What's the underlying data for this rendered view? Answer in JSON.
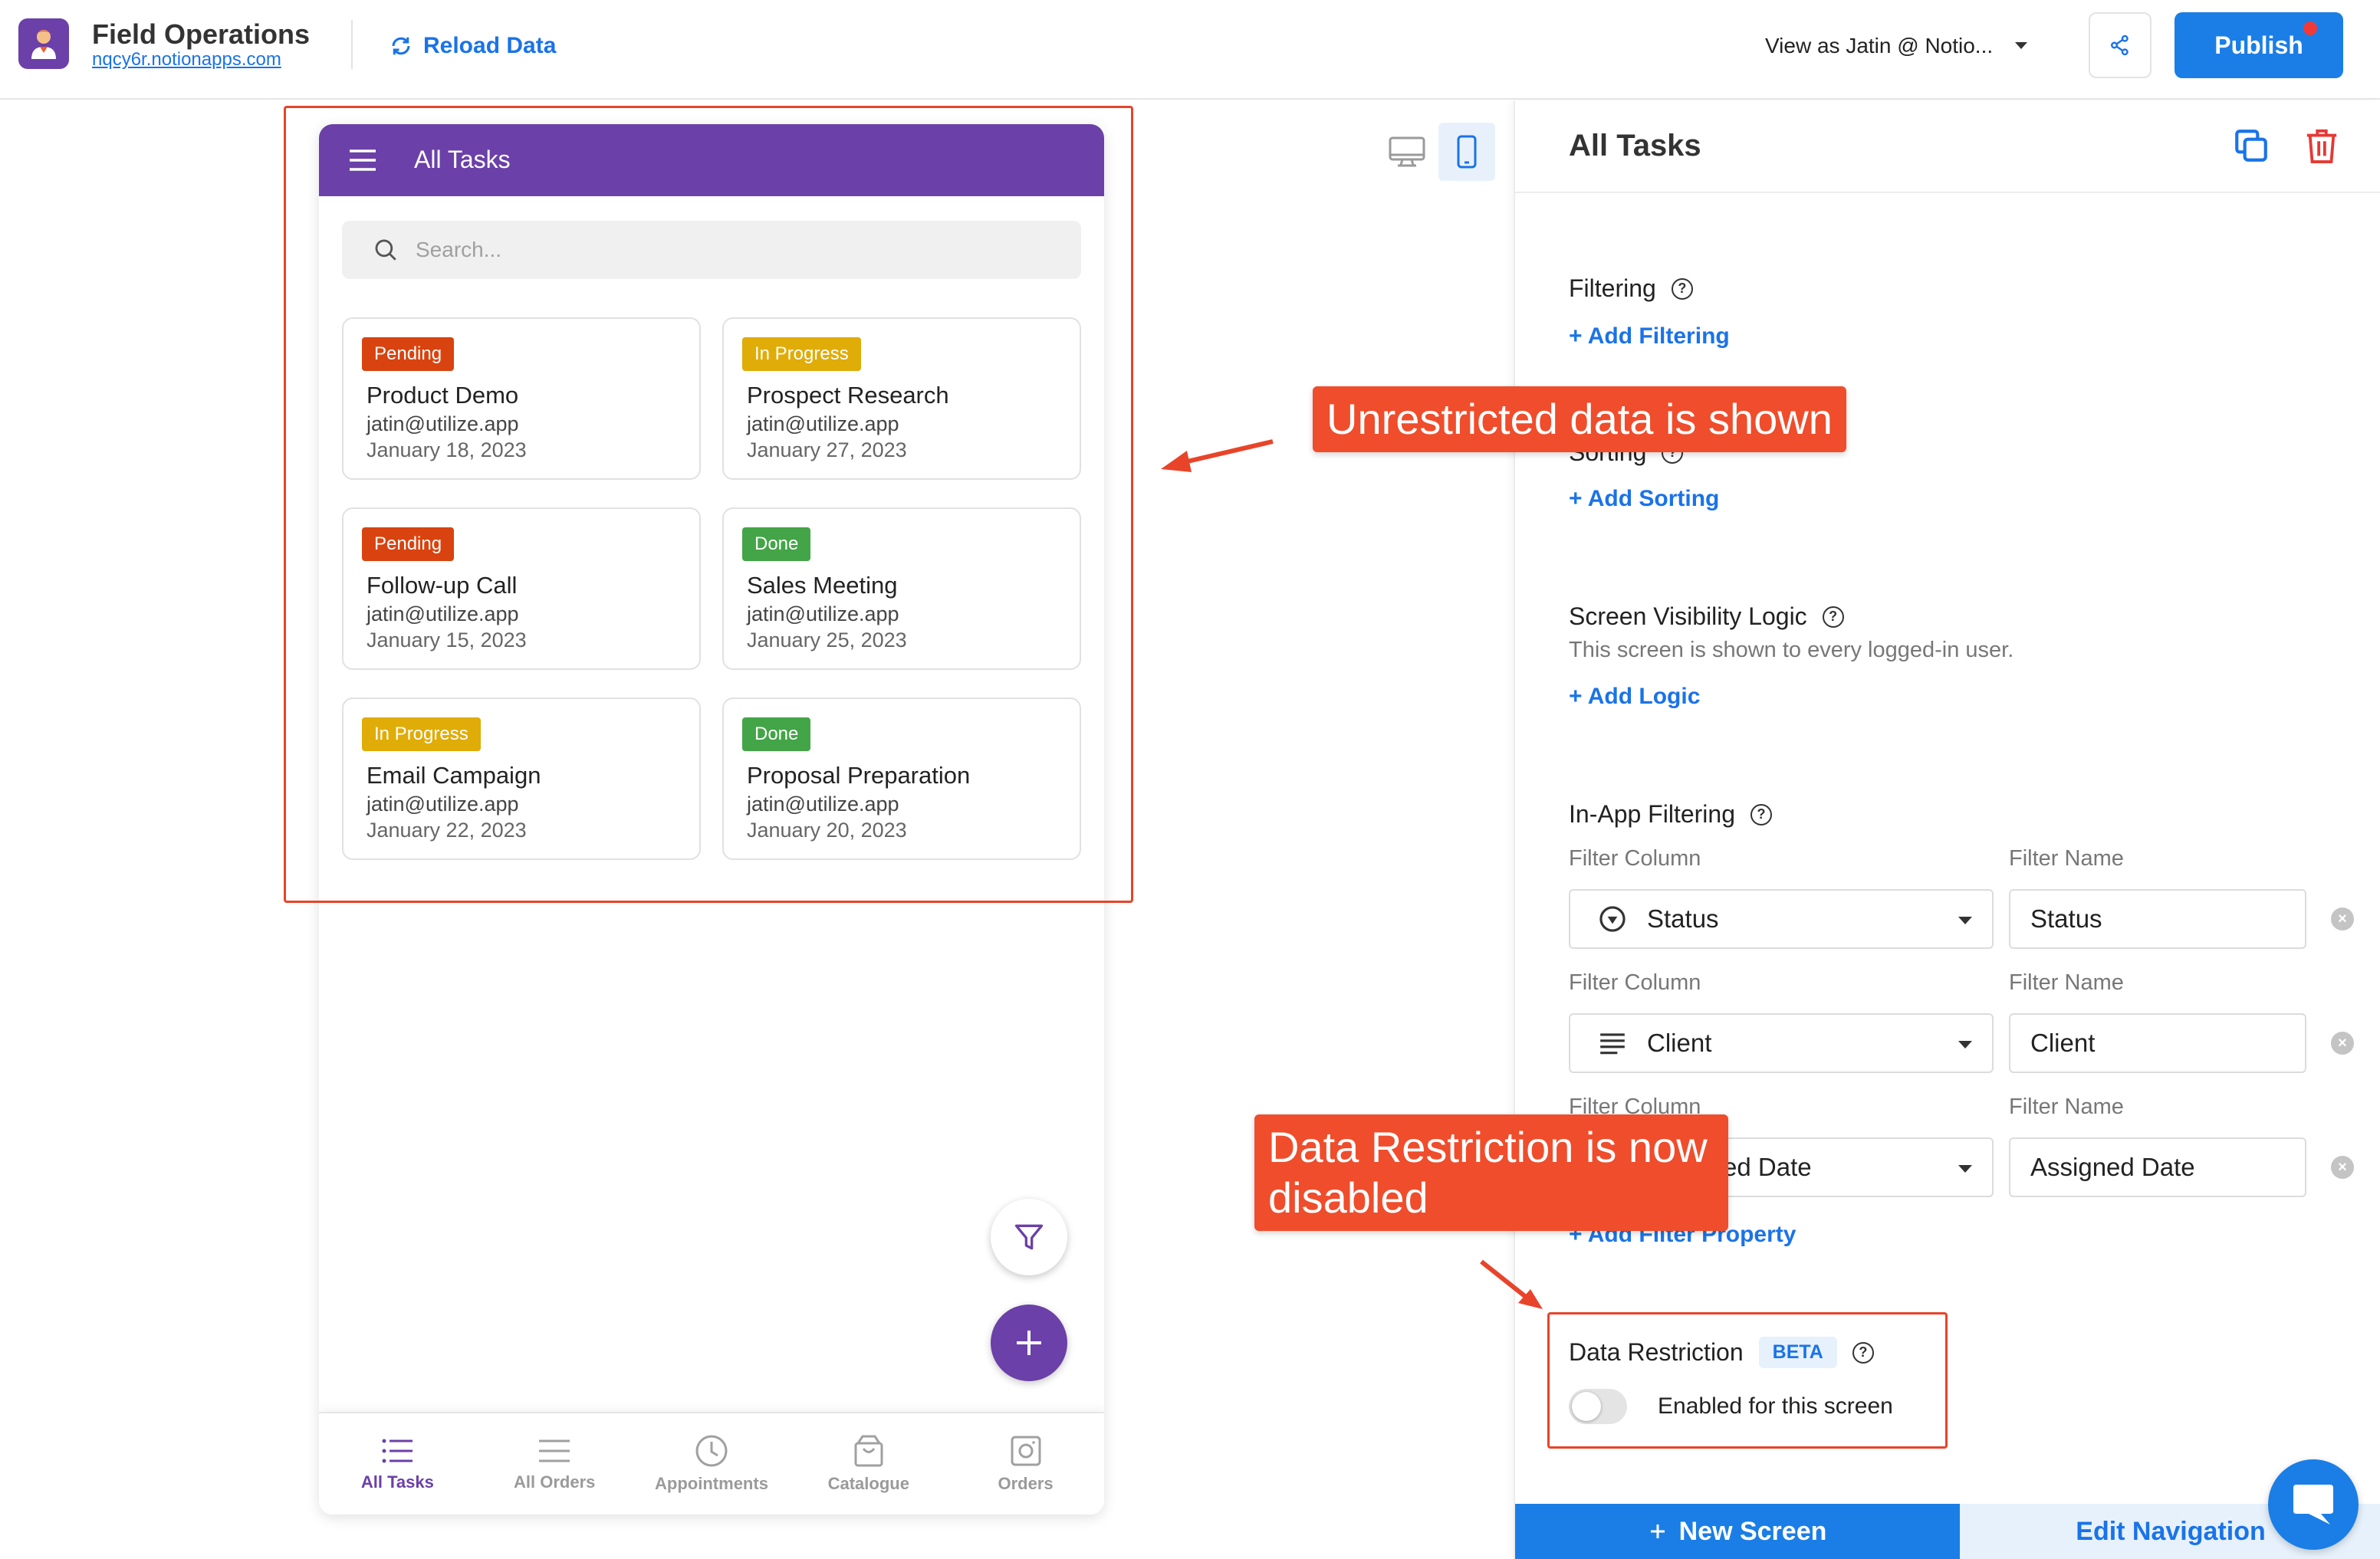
{
  "topbar": {
    "app_name": "Field Operations",
    "app_url": "nqcy6r.notionapps.com",
    "reload_label": "Reload Data",
    "view_as": "View as Jatin @ Notio...",
    "publish_label": "Publish"
  },
  "phone": {
    "screen_title": "All Tasks",
    "search_placeholder": "Search...",
    "cards": [
      {
        "status": "Pending",
        "status_color": "#d9430f",
        "title": "Product Demo",
        "email": "jatin@utilize.app",
        "date": "January 18, 2023"
      },
      {
        "status": "In Progress",
        "status_color": "#e0ac07",
        "title": "Prospect Research",
        "email": "jatin@utilize.app",
        "date": "January 27, 2023"
      },
      {
        "status": "Pending",
        "status_color": "#d9430f",
        "title": "Follow-up Call",
        "email": "jatin@utilize.app",
        "date": "January 15, 2023"
      },
      {
        "status": "Done",
        "status_color": "#43a547",
        "title": "Sales Meeting",
        "email": "jatin@utilize.app",
        "date": "January 25, 2023"
      },
      {
        "status": "In Progress",
        "status_color": "#e0ac07",
        "title": "Email Campaign",
        "email": "jatin@utilize.app",
        "date": "January 22, 2023"
      },
      {
        "status": "Done",
        "status_color": "#43a547",
        "title": "Proposal Preparation",
        "email": "jatin@utilize.app",
        "date": "January 20, 2023"
      }
    ],
    "bottom_nav": [
      {
        "label": "All Tasks",
        "icon": "list-icon",
        "active": true
      },
      {
        "label": "All Orders",
        "icon": "lines-icon",
        "active": false
      },
      {
        "label": "Appointments",
        "icon": "clock-icon",
        "active": false
      },
      {
        "label": "Catalogue",
        "icon": "bag-icon",
        "active": false
      },
      {
        "label": "Orders",
        "icon": "camera-icon",
        "active": false
      }
    ]
  },
  "panel": {
    "title": "All Tasks",
    "filtering": {
      "title": "Filtering",
      "add_label": "+ Add Filtering"
    },
    "sorting": {
      "title": "Sorting",
      "add_label": "+ Add Sorting"
    },
    "visibility": {
      "title": "Screen Visibility Logic",
      "description": "This screen is shown to every logged-in user.",
      "add_label": "+ Add Logic"
    },
    "in_app_filtering": {
      "title": "In-App Filtering",
      "column_label": "Filter Column",
      "name_label": "Filter Name",
      "rows": [
        {
          "column": "Status",
          "name": "Status",
          "icon": "status-icon"
        },
        {
          "column": "Client",
          "name": "Client",
          "icon": "text-lines-icon"
        },
        {
          "column": "Assigned Date",
          "name": "Assigned Date",
          "icon": "calendar-icon"
        }
      ],
      "add_label": "+ Add Filter Property"
    },
    "data_restriction": {
      "title": "Data Restriction",
      "badge": "BETA",
      "toggle_label": "Enabled for this screen",
      "enabled": false
    },
    "new_screen_label": "New Screen",
    "edit_nav_label": "Edit Navigation"
  },
  "annotations": {
    "unrestricted": "Unrestricted data is shown",
    "restriction_line1": "Data Restriction is now",
    "restriction_line2": "disabled"
  },
  "colors": {
    "brand_purple": "#6b40a8",
    "primary_blue": "#1a7ee6",
    "annotation_red": "#ef4d2c"
  }
}
